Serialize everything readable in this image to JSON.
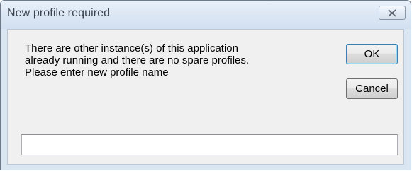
{
  "window": {
    "title": "New profile required"
  },
  "message": {
    "lines": [
      "There are other instance(s) of this application",
      "already running and there are no spare profiles.",
      "Please enter new profile name"
    ]
  },
  "buttons": {
    "ok_label": "OK",
    "cancel_label": "Cancel"
  },
  "profile_input": {
    "value": "",
    "placeholder": ""
  },
  "icons": {
    "close": "close-icon"
  }
}
